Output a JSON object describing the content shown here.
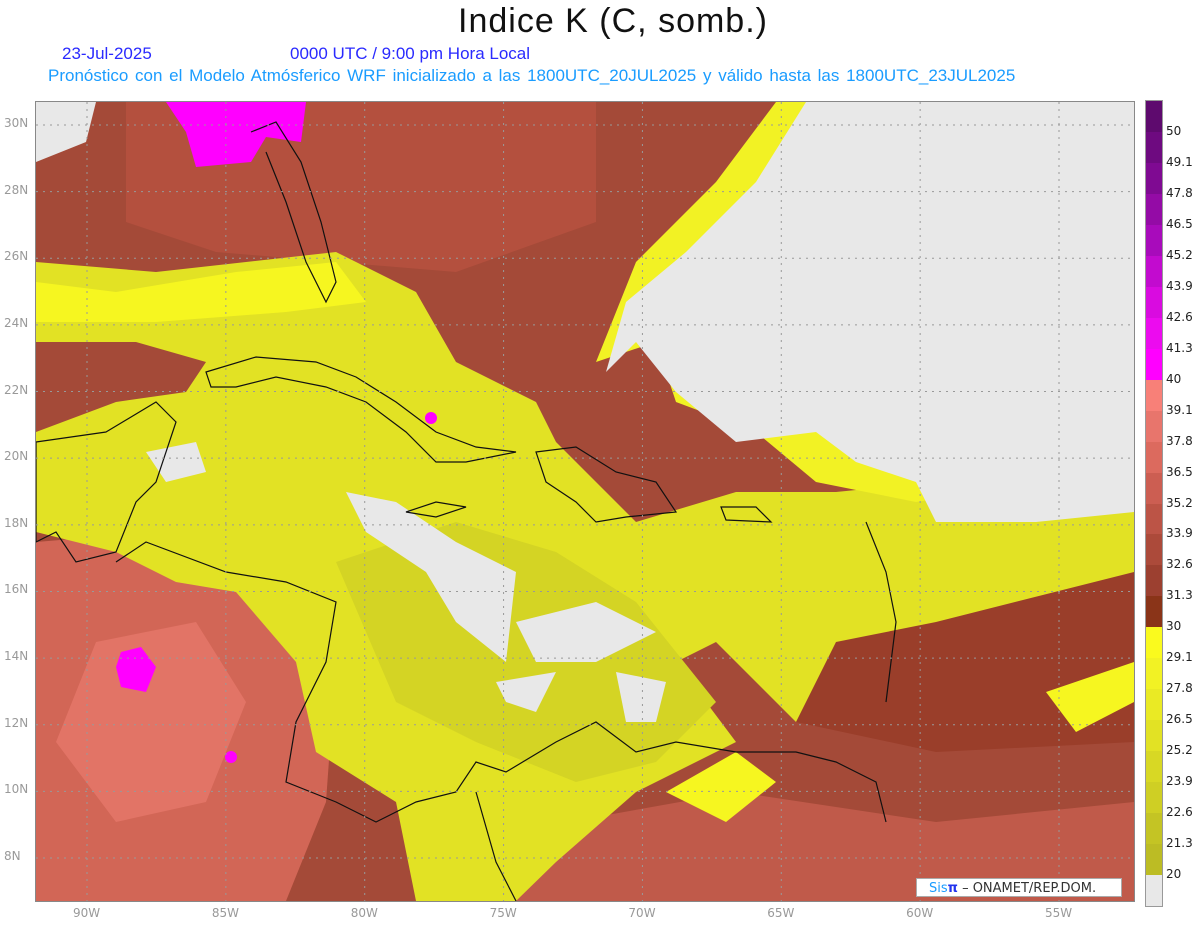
{
  "header": {
    "title": "Indice K (C, somb.)",
    "date": "23-Jul-2025",
    "time": "0000 UTC / 9:00 pm Hora Local",
    "description": "Pronóstico con el Modelo Atmósferico WRF inicializado a las 1800UTC_20JUL2025 y válido hasta las  1800UTC_23JUL2025"
  },
  "axes": {
    "lon_labels": [
      "90W",
      "85W",
      "80W",
      "75W",
      "70W",
      "65W",
      "60W",
      "55W"
    ],
    "lon_values": [
      -90,
      -85,
      -80,
      -75,
      -70,
      -65,
      -60,
      -55
    ],
    "lat_labels": [
      "30N",
      "28N",
      "26N",
      "24N",
      "22N",
      "20N",
      "18N",
      "16N",
      "14N",
      "12N",
      "10N",
      "8N"
    ],
    "lat_values": [
      30,
      28,
      26,
      24,
      22,
      20,
      18,
      16,
      14,
      12,
      10,
      8
    ]
  },
  "colorbar": {
    "labels": [
      "50",
      "49.1",
      "47.8",
      "46.5",
      "45.2",
      "43.9",
      "42.6",
      "41.3",
      "40",
      "39.1",
      "37.8",
      "36.5",
      "35.2",
      "33.9",
      "32.6",
      "31.3",
      "30",
      "29.1",
      "27.8",
      "26.5",
      "25.2",
      "23.9",
      "22.6",
      "21.3",
      "20"
    ],
    "colors": [
      "#5e0a6e",
      "#6e0a80",
      "#7f0a92",
      "#940ba6",
      "#a80bbb",
      "#c20bcf",
      "#d90be0",
      "#ec0bef",
      "#ff00ff",
      "#f88078",
      "#e8756c",
      "#dc6a5e",
      "#cc5e52",
      "#bc5446",
      "#ac4a3a",
      "#9c4030",
      "#8a3418",
      "#fafa1e",
      "#f2f224",
      "#eaea24",
      "#e2e224",
      "#d8d824",
      "#cfcf24",
      "#c4c424",
      "#bcbc24",
      "#e8e8e8"
    ]
  },
  "credit": {
    "sis": "Sis",
    "pi": "π",
    "rest": " –  ONAMET/REP.DOM."
  }
}
